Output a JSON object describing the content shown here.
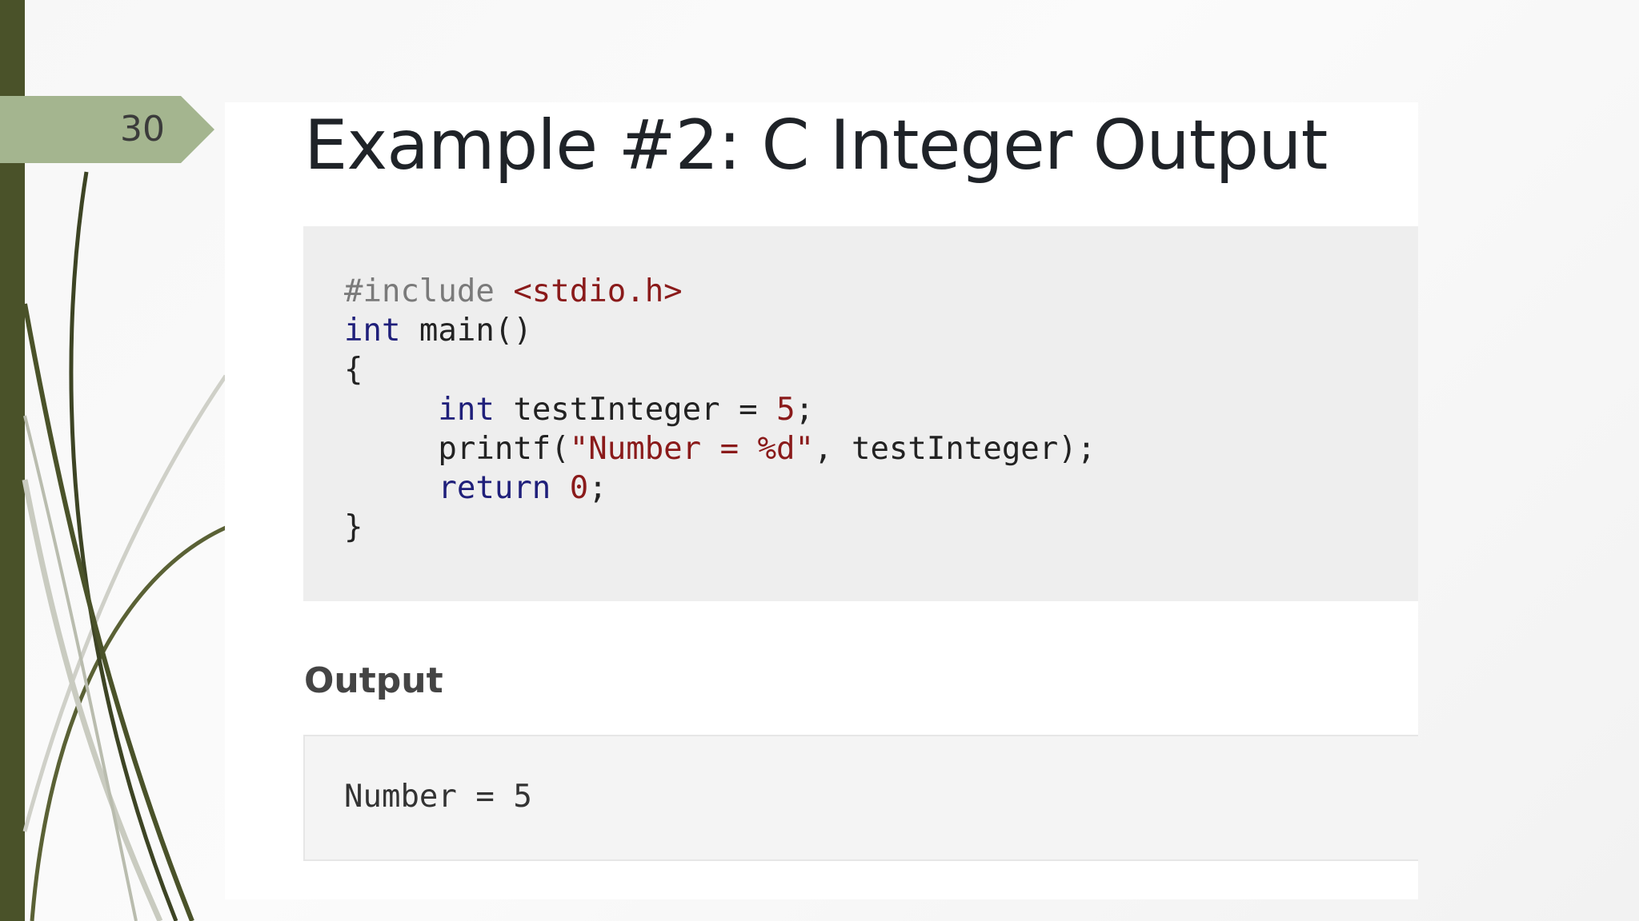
{
  "slide": {
    "number": "30",
    "title": "Example #2: C Integer Output"
  },
  "code": {
    "line1_directive": "#include ",
    "line1_header": "<stdio.h>",
    "line2_type": "int",
    "line2_rest": " main()",
    "line3": "{",
    "line4_indent": "     ",
    "line4_type": "int",
    "line4_rest": " testInteger = ",
    "line4_value": "5",
    "line4_end": ";",
    "line5_indent": "     ",
    "line5_call": "printf(",
    "line5_string": "\"Number = %d\"",
    "line5_rest": ", testInteger);",
    "line6_indent": "     ",
    "line6_keyword": "return",
    "line6_space": " ",
    "line6_value": "0",
    "line6_end": ";",
    "line7": "}"
  },
  "output": {
    "heading": "Output",
    "text": "Number = 5"
  },
  "colors": {
    "sidebar": "#4a5229",
    "tab": "#a4b58f",
    "code_background": "#eeeeee",
    "string_literal": "#8a1a1a",
    "keyword": "#1f1f7a"
  }
}
